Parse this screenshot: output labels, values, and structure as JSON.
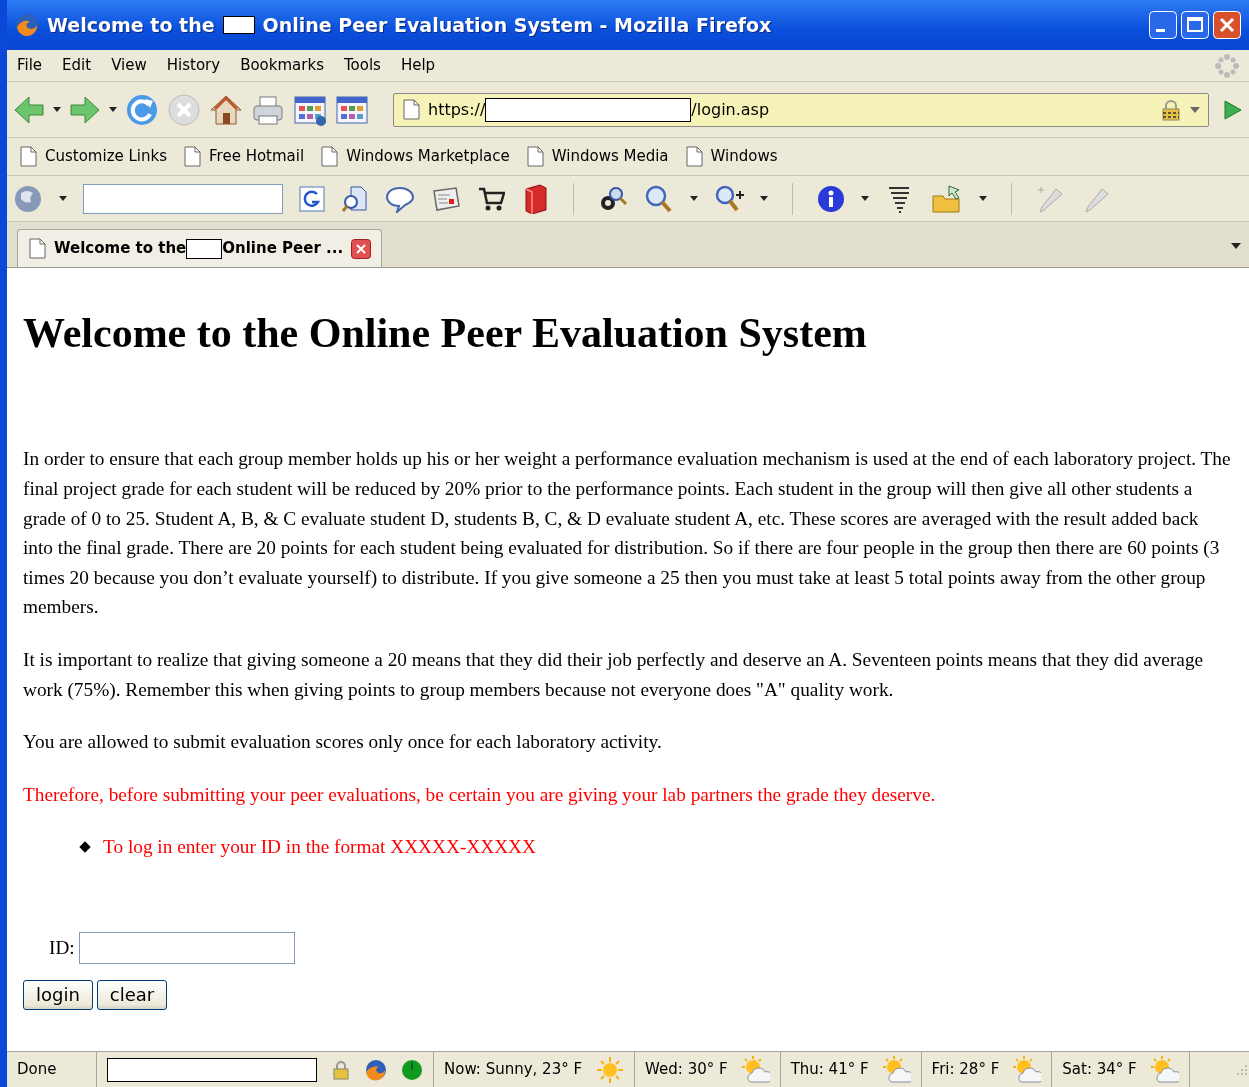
{
  "window": {
    "title_before": "Welcome to the",
    "title_after": "Online Peer Evaluation System - Mozilla Firefox"
  },
  "menu": [
    "File",
    "Edit",
    "View",
    "History",
    "Bookmarks",
    "Tools",
    "Help"
  ],
  "address": {
    "prefix": "https://",
    "suffix": "/login.asp"
  },
  "bookmarks": [
    "Customize Links",
    "Free Hotmail",
    "Windows Marketplace",
    "Windows Media",
    "Windows"
  ],
  "tab": {
    "label_before": "Welcome to the",
    "label_after": "Online Peer ...",
    "selected": true
  },
  "page": {
    "heading": "Welcome to the Online Peer Evaluation System",
    "paragraphs": [
      {
        "kind": "normal",
        "text": "In order to ensure that each group member holds up his or her weight a performance evaluation mechanism is used at the end of each laboratory project. The final project grade for each student will be reduced by 20% prior to the performance points. Each student in the group will then give all other students a grade of 0 to 25. Student A, B, & C evaluate student D, students B, C, & D evaluate student A, etc. These scores are averaged with the result added back into the final grade. There are 20 points for each student being evaluated for distribution. So if there are four people in the group then there are 60 points (3 times 20 because you don’t evaluate yourself) to distribute. If you give someone a 25 then you must take at least 5 total points away from the other group members."
      },
      {
        "kind": "normal",
        "text": "It is important to realize that giving someone a 20 means that they did their job perfectly and deserve an A. Seventeen points means that they did average work (75%). Remember this when giving points to group members because not everyone does \"A\" quality work."
      },
      {
        "kind": "normal",
        "text": "You are allowed to submit evaluation scores only once for each laboratory activity."
      },
      {
        "kind": "warning",
        "text": "Therefore, before submitting your peer evaluations, be certain you are giving your lab partners the grade they deserve."
      }
    ],
    "bullets": [
      "To log in enter your ID in the format XXXXX-XXXXX"
    ],
    "id_label": "ID:",
    "buttons": [
      "login",
      "clear"
    ]
  },
  "status_bar": {
    "status": "Done",
    "weather": [
      {
        "text": "Now: Sunny, 23° F",
        "kind": "sunny"
      },
      {
        "text": "Wed: 30° F",
        "kind": "partly_cloudy"
      },
      {
        "text": "Thu: 41° F",
        "kind": "partly_cloudy"
      },
      {
        "text": "Fri: 28° F",
        "kind": "partly_cloudy"
      },
      {
        "text": "Sat: 34° F",
        "kind": "partly_cloudy"
      }
    ]
  }
}
